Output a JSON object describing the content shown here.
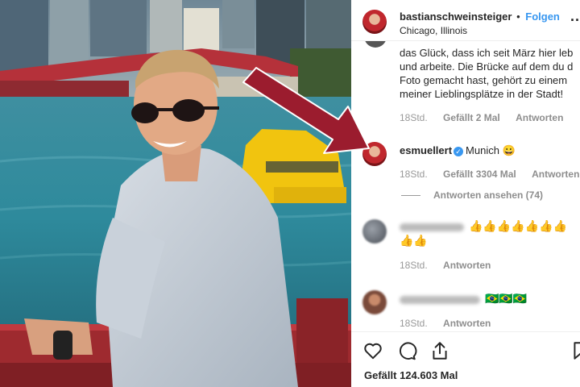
{
  "post": {
    "author": "bastianschweinsteiger",
    "follow_label": "Folgen",
    "separator": "•",
    "location": "Chicago, Illinois",
    "more_label": "..."
  },
  "comments": {
    "owner_reply": {
      "lines": [
        "das Glück, dass ich seit März hier leb",
        "und arbeite. Die Brücke auf dem du d",
        "Foto gemacht hast, gehört zu einem",
        "meiner Lieblingsplätze in der Stadt!"
      ],
      "time": "18Std.",
      "likes": "Gefällt 2 Mal",
      "reply_label": "Antworten"
    },
    "muller": {
      "user": "esmuellert",
      "verified_icon": "verified-badge-icon",
      "text": "Munich 😀",
      "time": "18Std.",
      "likes": "Gefällt 3304 Mal",
      "reply_label": "Antworten",
      "view_replies": "Antworten ansehen (74)"
    },
    "thumbs_comment": {
      "emoji_line1": "👍👍👍👍👍👍👍",
      "emoji_line2": "👍👍",
      "time": "18Std.",
      "reply_label": "Antworten"
    },
    "flags_comment": {
      "emoji": "🇧🇷🇧🇷🇧🇷",
      "time": "18Std.",
      "reply_label": "Antworten"
    }
  },
  "actions": {
    "icons": [
      "heart-icon",
      "comment-icon",
      "share-icon",
      "bookmark-icon"
    ],
    "likes_text": "Gefällt 124.603 Mal"
  },
  "colors": {
    "link_blue": "#3897f0",
    "arrow_red": "#9b1c2e",
    "text": "#262626",
    "meta_grey": "#999999"
  }
}
